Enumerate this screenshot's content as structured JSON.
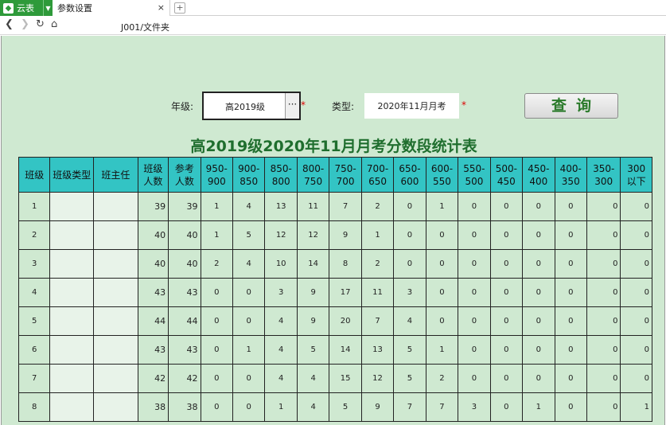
{
  "tabbar": {
    "app_label": "云表",
    "tab_title": "参数设置",
    "close_glyph": "×",
    "new_tab_glyph": "+"
  },
  "navbar": {
    "path": "J001/文件夹"
  },
  "filters": {
    "grade_label": "年级:",
    "grade_value": "高2019级",
    "more_glyph": "···",
    "type_label": "类型:",
    "type_value": "2020年11月月考",
    "required_mark": "*",
    "query_label": "查询"
  },
  "report": {
    "title": "高2019级2020年11月月考分数段统计表",
    "headers": [
      "班级",
      "班级类型",
      "班主任",
      "班级人数",
      "参考人数",
      "950-900",
      "900-850",
      "850-800",
      "800-750",
      "750-700",
      "700-650",
      "650-600",
      "600-550",
      "550-500",
      "500-450",
      "450-400",
      "400-350",
      "350-300",
      "300以下"
    ],
    "rows": [
      [
        "1",
        "",
        "",
        "39",
        "39",
        "1",
        "4",
        "13",
        "11",
        "7",
        "2",
        "0",
        "1",
        "0",
        "0",
        "0",
        "0",
        "0",
        "0"
      ],
      [
        "2",
        "",
        "",
        "40",
        "40",
        "1",
        "5",
        "12",
        "12",
        "9",
        "1",
        "0",
        "0",
        "0",
        "0",
        "0",
        "0",
        "0",
        "0"
      ],
      [
        "3",
        "",
        "",
        "40",
        "40",
        "2",
        "4",
        "10",
        "14",
        "8",
        "2",
        "0",
        "0",
        "0",
        "0",
        "0",
        "0",
        "0",
        "0"
      ],
      [
        "4",
        "",
        "",
        "43",
        "43",
        "0",
        "0",
        "3",
        "9",
        "17",
        "11",
        "3",
        "0",
        "0",
        "0",
        "0",
        "0",
        "0",
        "0"
      ],
      [
        "5",
        "",
        "",
        "44",
        "44",
        "0",
        "0",
        "4",
        "9",
        "20",
        "7",
        "4",
        "0",
        "0",
        "0",
        "0",
        "0",
        "0",
        "0"
      ],
      [
        "6",
        "",
        "",
        "43",
        "43",
        "0",
        "1",
        "4",
        "5",
        "14",
        "13",
        "5",
        "1",
        "0",
        "0",
        "0",
        "0",
        "0",
        "0"
      ],
      [
        "7",
        "",
        "",
        "42",
        "42",
        "0",
        "0",
        "4",
        "4",
        "15",
        "12",
        "5",
        "2",
        "0",
        "0",
        "0",
        "0",
        "0",
        "0"
      ],
      [
        "8",
        "",
        "",
        "38",
        "38",
        "0",
        "0",
        "1",
        "4",
        "5",
        "9",
        "7",
        "7",
        "3",
        "0",
        "1",
        "0",
        "0",
        "1"
      ]
    ]
  },
  "colors": {
    "header_bg": "#33c4c4",
    "page_bg": "#cfe9d1",
    "title_color": "#1f6e2e",
    "app_green": "#2e9a3a"
  }
}
